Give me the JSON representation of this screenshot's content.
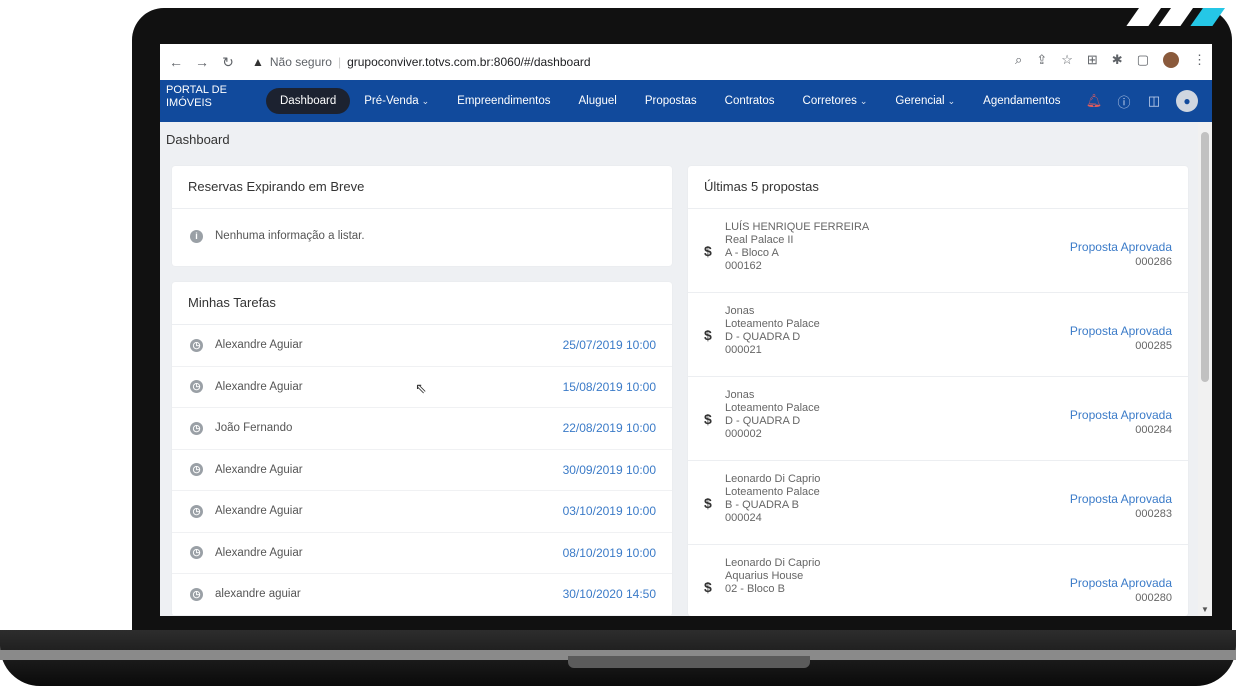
{
  "browser": {
    "not_secure": "Não seguro",
    "url": "grupoconviver.totvs.com.br:8060/#/dashboard"
  },
  "app": {
    "brand_line1": "PORTAL DE",
    "brand_line2": "IMÓVEIS",
    "menu": [
      {
        "label": "Dashboard",
        "active": true
      },
      {
        "label": "Pré-Venda",
        "dropdown": true
      },
      {
        "label": "Empreendimentos"
      },
      {
        "label": "Aluguel"
      },
      {
        "label": "Propostas"
      },
      {
        "label": "Contratos"
      },
      {
        "label": "Corretores",
        "dropdown": true
      },
      {
        "label": "Gerencial",
        "dropdown": true
      },
      {
        "label": "Agendamentos"
      }
    ]
  },
  "page": {
    "title": "Dashboard"
  },
  "reservas": {
    "title": "Reservas Expirando em Breve",
    "empty": "Nenhuma informação a listar."
  },
  "tarefas": {
    "title": "Minhas Tarefas",
    "items": [
      {
        "name": "Alexandre Aguiar",
        "date": "25/07/2019 10:00"
      },
      {
        "name": "Alexandre Aguiar",
        "date": "15/08/2019 10:00"
      },
      {
        "name": "João Fernando",
        "date": "22/08/2019 10:00"
      },
      {
        "name": "Alexandre Aguiar",
        "date": "30/09/2019 10:00"
      },
      {
        "name": "Alexandre Aguiar",
        "date": "03/10/2019 10:00"
      },
      {
        "name": "Alexandre Aguiar",
        "date": "08/10/2019 10:00"
      },
      {
        "name": "alexandre aguiar",
        "date": "30/10/2020 14:50"
      }
    ]
  },
  "propostas": {
    "title": "Últimas 5 propostas",
    "items": [
      {
        "client": "LUÍS HENRIQUE FERREIRA",
        "project": "Real Palace II",
        "unit": "A - Bloco A",
        "code": "000162",
        "status": "Proposta Aprovada",
        "number": "000286"
      },
      {
        "client": "Jonas",
        "project": "Loteamento Palace",
        "unit": "D - QUADRA D",
        "code": "000021",
        "status": "Proposta Aprovada",
        "number": "000285"
      },
      {
        "client": "Jonas",
        "project": "Loteamento Palace",
        "unit": "D - QUADRA D",
        "code": "000002",
        "status": "Proposta Aprovada",
        "number": "000284"
      },
      {
        "client": "Leonardo Di Caprio",
        "project": "Loteamento Palace",
        "unit": "B - QUADRA B",
        "code": "000024",
        "status": "Proposta Aprovada",
        "number": "000283"
      },
      {
        "client": "Leonardo Di Caprio",
        "project": "Aquarius House",
        "unit": "02 - Bloco B",
        "code": "",
        "status": "Proposta Aprovada",
        "number": "000280"
      }
    ]
  },
  "colors": {
    "navbar": "#114a9c",
    "active_pill": "#1c2230",
    "link": "#3b7bc8"
  }
}
